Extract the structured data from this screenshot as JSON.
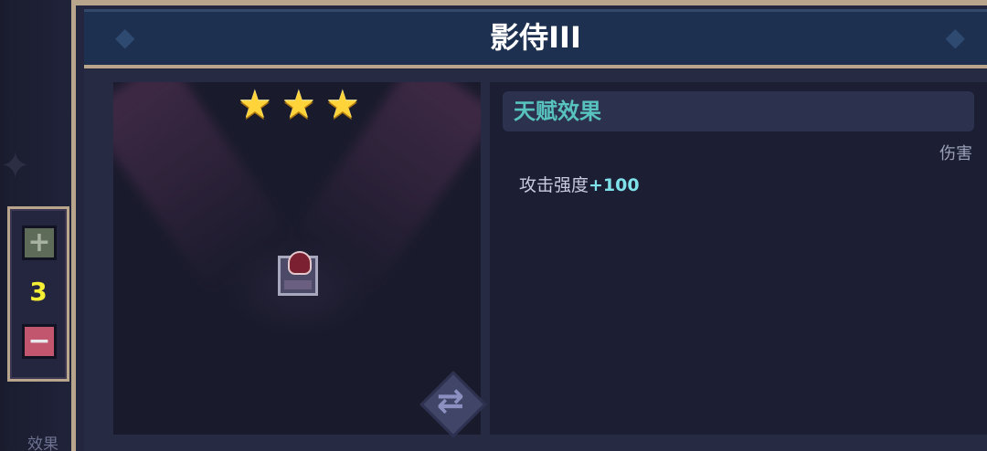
{
  "window": {
    "title": "影侍III"
  },
  "stepper": {
    "plus_label": "+",
    "count": "3",
    "minus_label": "−"
  },
  "left_label": "效果",
  "showcase": {
    "stars_count": 3,
    "stars": [
      "★",
      "★",
      "★"
    ],
    "swap_icon": "⇄"
  },
  "talent": {
    "header": "天赋效果",
    "tag": "伤害",
    "effect_label": "攻击强度",
    "effect_value": "+100"
  },
  "colors": {
    "frame_gold": "#b8a58c",
    "title_bar": "#1d3050",
    "header_accent": "#58c3be",
    "effect_value": "#7fe2ea",
    "count_yellow": "#f4ee34",
    "minus_red": "#c2566e"
  }
}
